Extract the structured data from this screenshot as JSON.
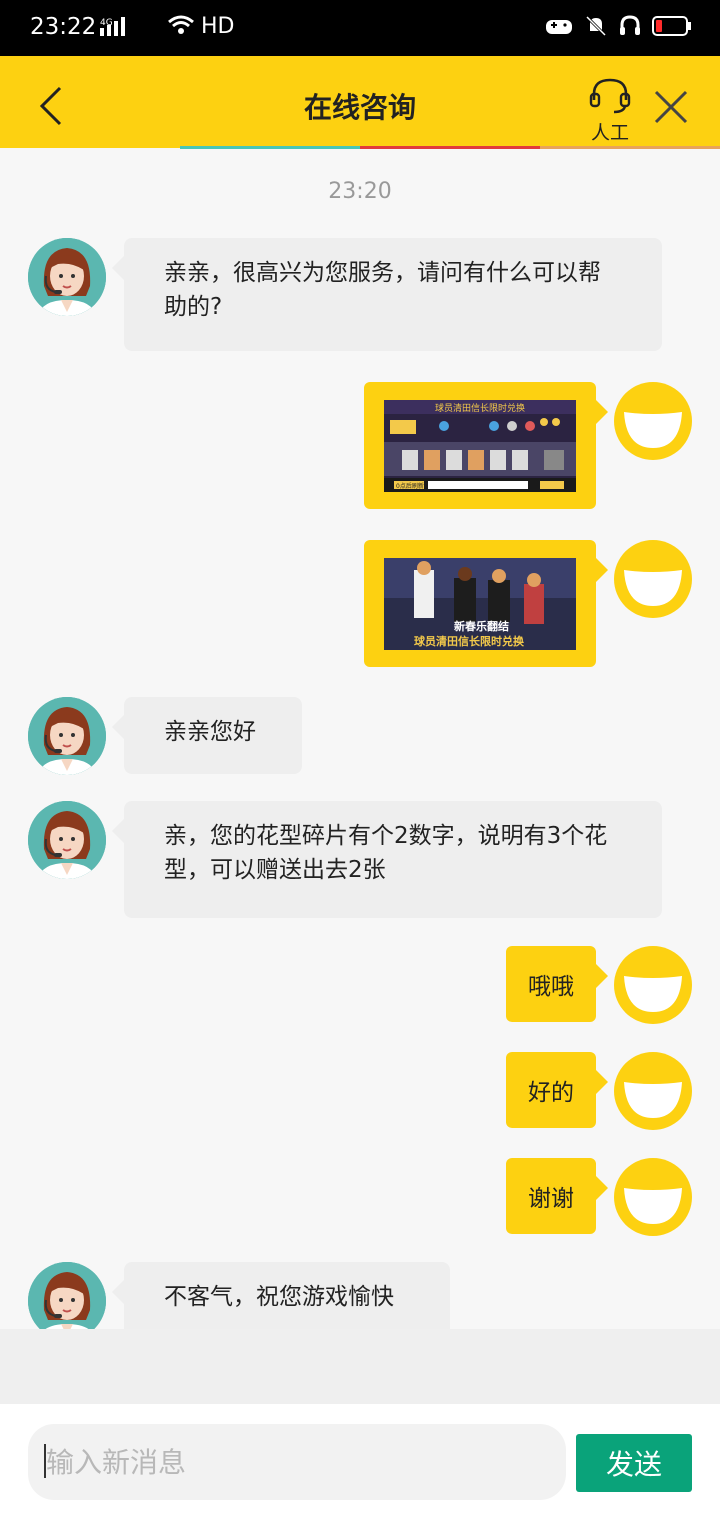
{
  "status_bar": {
    "time": "23:22",
    "network": "4G",
    "hd": "HD"
  },
  "header": {
    "title": "在线咨询",
    "agent_label": "人工"
  },
  "colors": {
    "brand_yellow": "#fdd111",
    "send_green": "#0aa37a"
  },
  "chat": {
    "timestamp": "23:20",
    "messages": [
      {
        "from": "agent",
        "text": "亲亲，很高兴为您服务，请问有什么可以帮助的?"
      },
      {
        "from": "user",
        "type": "image",
        "image_icon": "game-screenshot-exchange-icon"
      },
      {
        "from": "user",
        "type": "image",
        "image_icon": "game-banner-icon"
      },
      {
        "from": "agent",
        "text": "亲亲您好"
      },
      {
        "from": "agent",
        "text": "亲，您的花型碎片有个2数字，说明有3个花型，可以赠送出去2张"
      },
      {
        "from": "user",
        "text": "哦哦"
      },
      {
        "from": "user",
        "text": "好的"
      },
      {
        "from": "user",
        "text": "谢谢"
      },
      {
        "from": "agent",
        "text": "不客气，祝您游戏愉快"
      }
    ],
    "img1_text": {
      "banner": "球员清田信长限时兑换",
      "footer": "0点后刷新"
    },
    "img2_text": {
      "line1": "新春乐翻结",
      "line2": "球员清田信长限时兑换"
    }
  },
  "input": {
    "placeholder": "输入新消息",
    "value": ""
  },
  "send_label": "发送"
}
